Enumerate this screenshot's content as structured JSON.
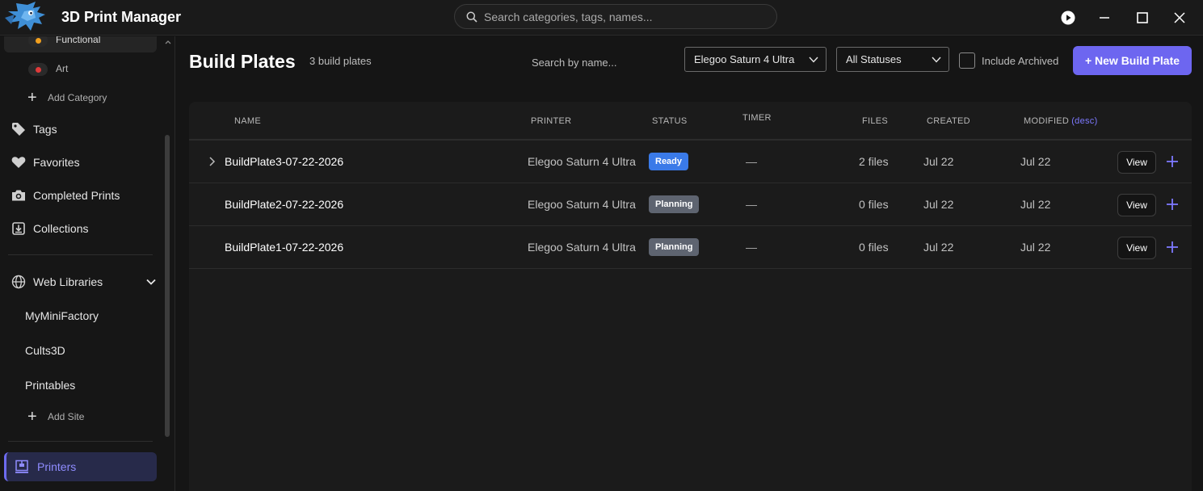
{
  "app": {
    "title": "3D Print Manager",
    "search_placeholder": "Search categories, tags, names..."
  },
  "sidebar": {
    "categories": [
      {
        "label": "Functional",
        "dot_color": "#f2a01e"
      },
      {
        "label": "Art",
        "dot_color": "#e03a3a"
      }
    ],
    "add_category_label": "Add Category",
    "nav": [
      {
        "label": "Tags",
        "icon": "tag-icon"
      },
      {
        "label": "Favorites",
        "icon": "heart-icon"
      },
      {
        "label": "Completed Prints",
        "icon": "camera-icon"
      },
      {
        "label": "Collections",
        "icon": "download-box-icon"
      }
    ],
    "web_libraries_label": "Web Libraries",
    "sites": [
      "MyMiniFactory",
      "Cults3D",
      "Printables"
    ],
    "add_site_label": "Add Site",
    "printers_label": "Printers"
  },
  "main": {
    "title": "Build Plates",
    "count": "3 build plates",
    "name_search_placeholder": "Search by name...",
    "printer_filter": "Elegoo Saturn 4 Ultra",
    "status_filter": "All Statuses",
    "include_archived_label": "Include Archived",
    "new_button_label": "+ New Build Plate"
  },
  "table": {
    "columns": {
      "name": "NAME",
      "printer": "PRINTER",
      "status": "STATUS",
      "timer": "TIMER",
      "files": "FILES",
      "created": "CREATED",
      "modified": "MODIFIED",
      "modified_sort": "(desc)"
    },
    "rows": [
      {
        "name": "BuildPlate3-07-22-2026",
        "printer": "Elegoo Saturn 4 Ultra",
        "status": "Ready",
        "timer": "—",
        "files": "2 files",
        "created": "Jul 22",
        "modified": "Jul 22",
        "view": "View"
      },
      {
        "name": "BuildPlate2-07-22-2026",
        "printer": "Elegoo Saturn 4 Ultra",
        "status": "Planning",
        "timer": "—",
        "files": "0 files",
        "created": "Jul 22",
        "modified": "Jul 22",
        "view": "View"
      },
      {
        "name": "BuildPlate1-07-22-2026",
        "printer": "Elegoo Saturn 4 Ultra",
        "status": "Planning",
        "timer": "—",
        "files": "0 files",
        "created": "Jul 22",
        "modified": "Jul 22",
        "view": "View"
      }
    ]
  },
  "colors": {
    "accent": "#6d66f0",
    "ready_badge": "#3a7ae8",
    "planning_badge": "#5e6470"
  }
}
